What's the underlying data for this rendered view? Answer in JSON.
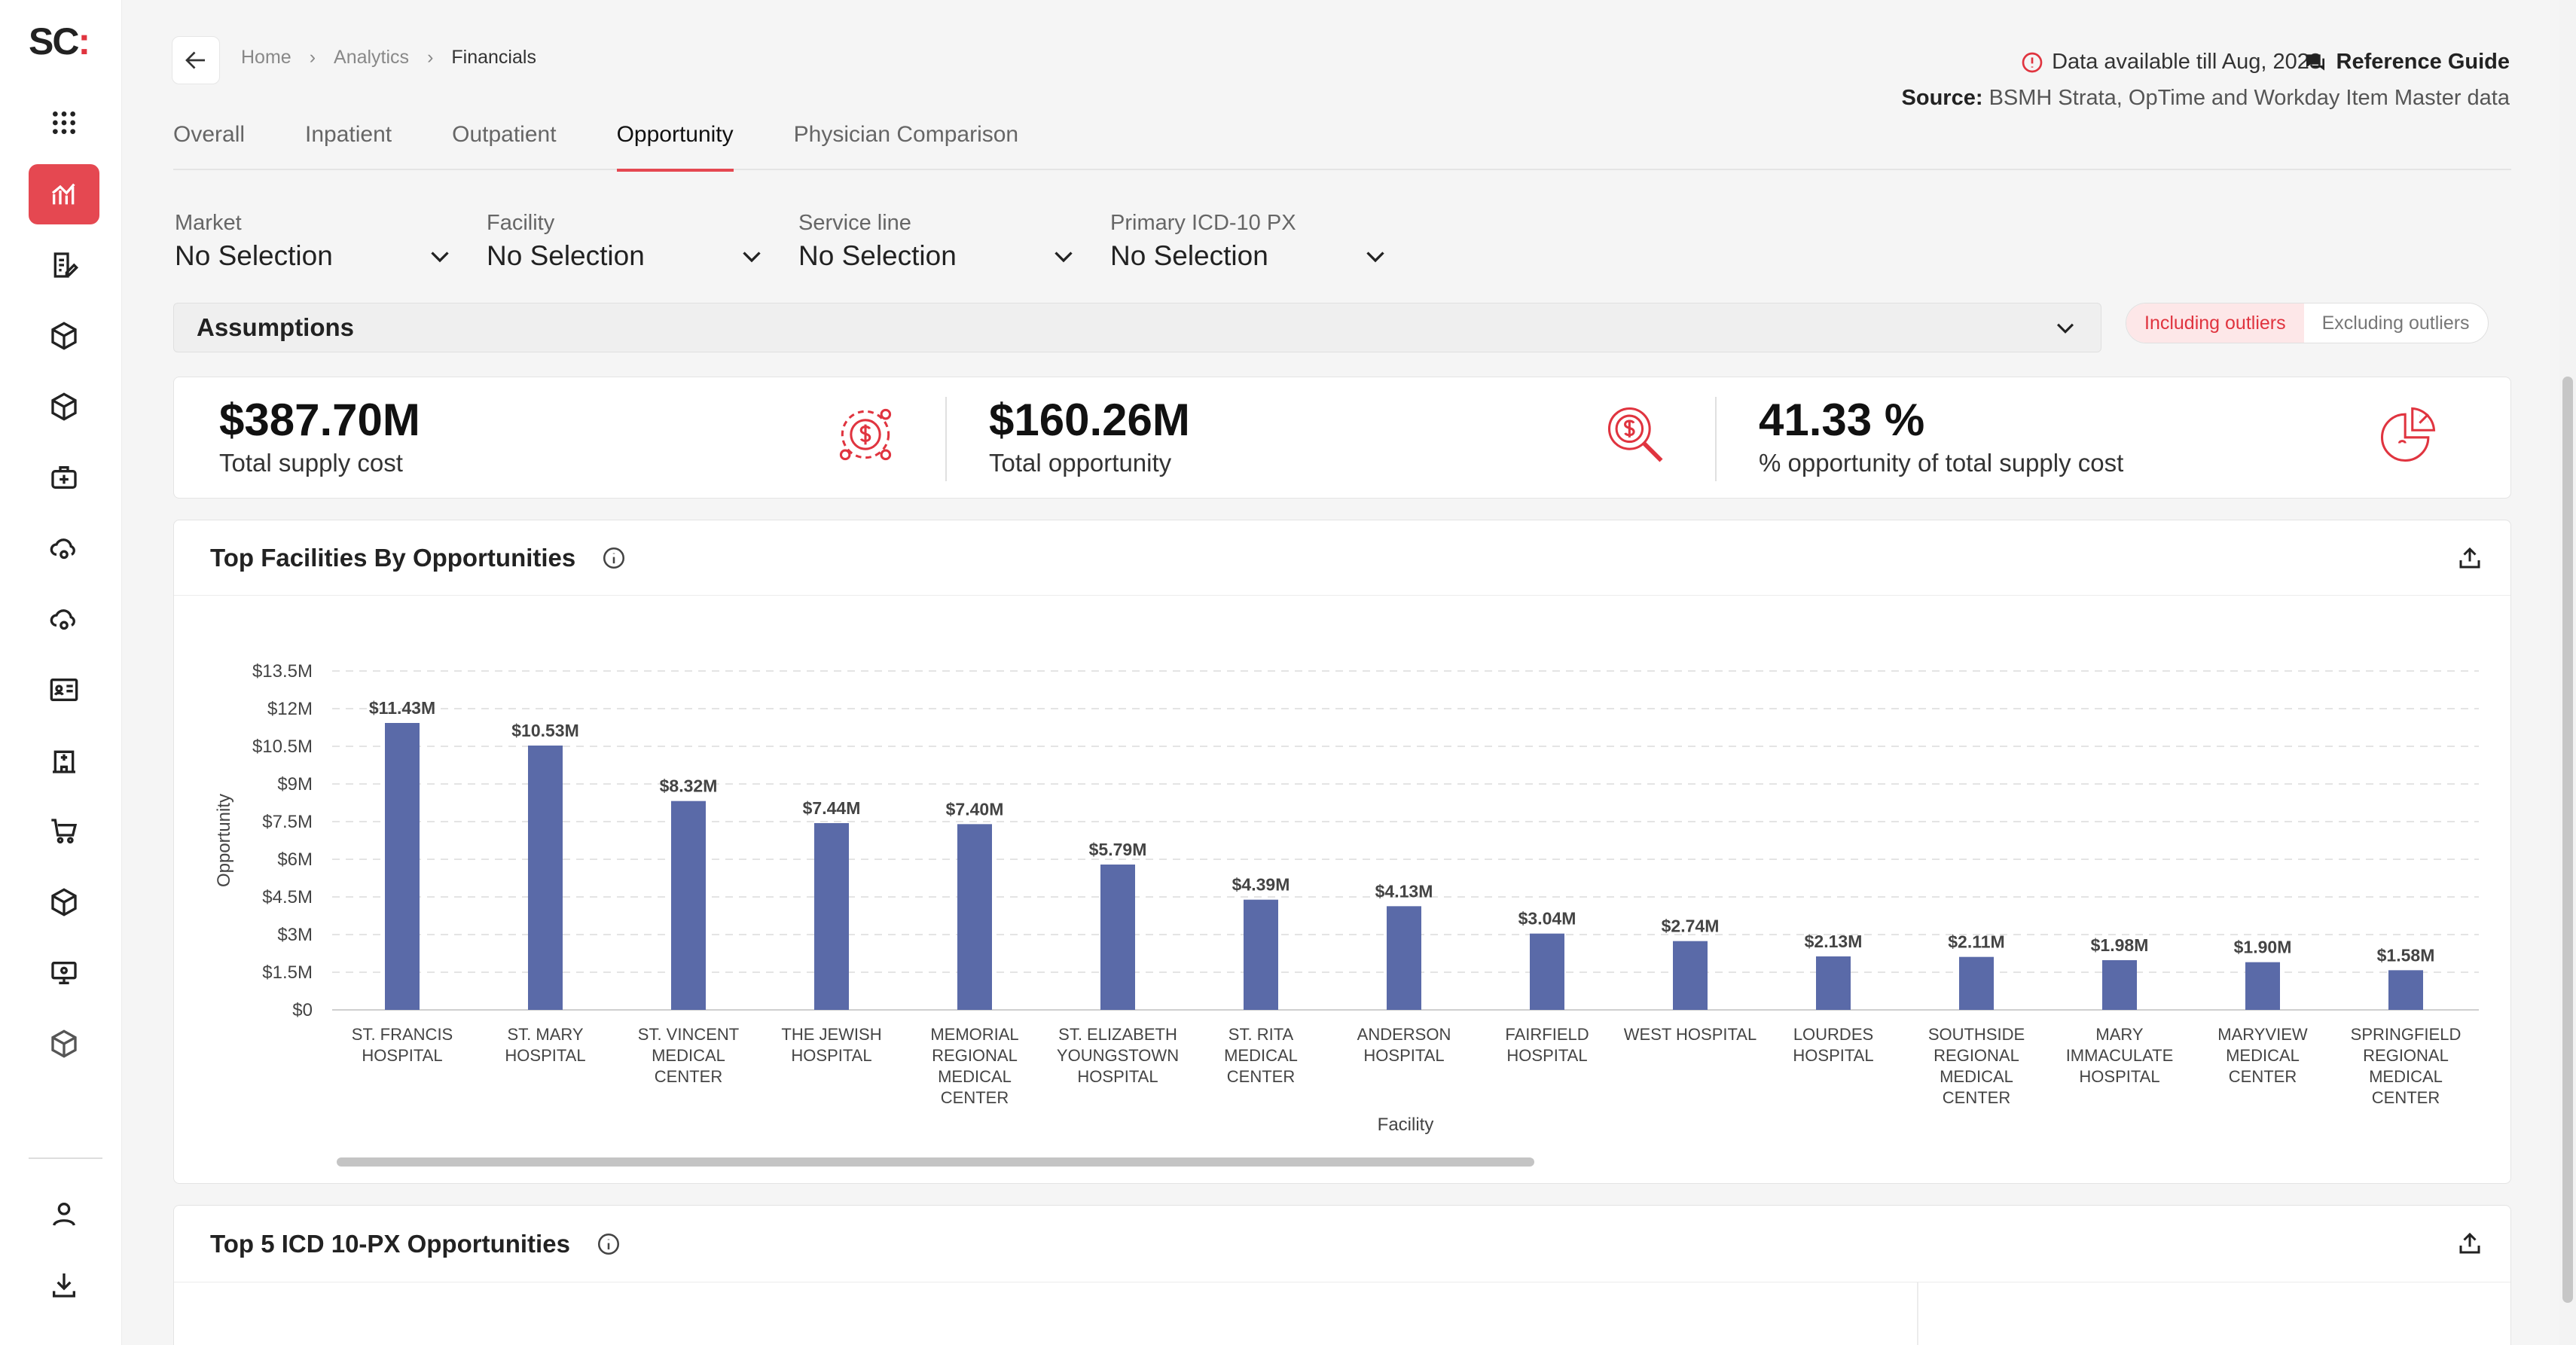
{
  "app": {
    "logo_text": "SC",
    "logo_mark": ":"
  },
  "sidebar": {
    "items": [
      {
        "name": "apps-grid-icon"
      },
      {
        "name": "analytics-chart-icon",
        "active": true
      },
      {
        "name": "document-edit-icon"
      },
      {
        "name": "box-icon"
      },
      {
        "name": "box-icon"
      },
      {
        "name": "medical-kit-icon"
      },
      {
        "name": "cloud-settings-icon"
      },
      {
        "name": "cloud-settings-icon"
      },
      {
        "name": "id-card-icon"
      },
      {
        "name": "hospital-building-icon"
      },
      {
        "name": "cart-icon"
      },
      {
        "name": "box-icon"
      },
      {
        "name": "monitor-icon"
      },
      {
        "name": "box-icon"
      }
    ],
    "bottom": [
      {
        "name": "user-icon"
      },
      {
        "name": "download-icon"
      }
    ]
  },
  "breadcrumb": {
    "home": "Home",
    "analytics": "Analytics",
    "current": "Financials"
  },
  "header": {
    "data_note": "Data available till Aug, 2023",
    "reference_guide": "Reference Guide",
    "source_label": "Source:",
    "source_text": " BSMH Strata, OpTime and Workday Item Master data"
  },
  "tabs": [
    {
      "label": "Overall",
      "active": false
    },
    {
      "label": "Inpatient",
      "active": false
    },
    {
      "label": "Outpatient",
      "active": false
    },
    {
      "label": "Opportunity",
      "active": true
    },
    {
      "label": "Physician Comparison",
      "active": false
    }
  ],
  "filters": [
    {
      "label": "Market",
      "value": "No Selection"
    },
    {
      "label": "Facility",
      "value": "No Selection"
    },
    {
      "label": "Service line",
      "value": "No Selection"
    },
    {
      "label": "Primary ICD-10 PX",
      "value": "No Selection"
    }
  ],
  "assumptions": {
    "title": "Assumptions"
  },
  "outliers": {
    "including": "Including outliers",
    "excluding": "Excluding outliers",
    "selected": "including"
  },
  "kpis": [
    {
      "value": "$387.70M",
      "label": "Total supply cost",
      "icon": "money-gear-icon"
    },
    {
      "value": "$160.26M",
      "label": "Total opportunity",
      "icon": "dollar-search-icon"
    },
    {
      "value": "41.33 %",
      "label": "% opportunity of total supply cost",
      "icon": "pie-percent-icon"
    }
  ],
  "colors": {
    "accent": "#e54851",
    "bar": "#5a6aa8"
  },
  "chart_card": {
    "title": "Top Facilities By Opportunities"
  },
  "chart_data": {
    "type": "bar",
    "title": "Top Facilities By Opportunities",
    "xlabel": "Facility",
    "ylabel": "Opportunity",
    "categories": [
      "ST. FRANCIS HOSPITAL",
      "ST. MARY HOSPITAL",
      "ST. VINCENT MEDICAL CENTER",
      "THE JEWISH HOSPITAL",
      "MEMORIAL REGIONAL MEDICAL CENTER",
      "ST. ELIZABETH YOUNGSTOWN HOSPITAL",
      "ST. RITA MEDICAL CENTER",
      "ANDERSON HOSPITAL",
      "FAIRFIELD HOSPITAL",
      "WEST HOSPITAL",
      "LOURDES HOSPITAL",
      "SOUTHSIDE REGIONAL MEDICAL CENTER",
      "MARY IMMACULATE HOSPITAL",
      "MARYVIEW MEDICAL CENTER",
      "SPRINGFIELD REGIONAL MEDICAL CENTER"
    ],
    "category_lines": [
      [
        "ST. FRANCIS",
        "HOSPITAL"
      ],
      [
        "ST. MARY",
        "HOSPITAL"
      ],
      [
        "ST. VINCENT",
        "MEDICAL",
        "CENTER"
      ],
      [
        "THE JEWISH",
        "HOSPITAL"
      ],
      [
        "MEMORIAL",
        "REGIONAL",
        "MEDICAL",
        "CENTER"
      ],
      [
        "ST. ELIZABETH",
        "YOUNGSTOWN",
        "HOSPITAL"
      ],
      [
        "ST. RITA",
        "MEDICAL",
        "CENTER"
      ],
      [
        "ANDERSON",
        "HOSPITAL"
      ],
      [
        "FAIRFIELD",
        "HOSPITAL"
      ],
      [
        "WEST HOSPITAL"
      ],
      [
        "LOURDES",
        "HOSPITAL"
      ],
      [
        "SOUTHSIDE",
        "REGIONAL",
        "MEDICAL",
        "CENTER"
      ],
      [
        "MARY",
        "IMMACULATE",
        "HOSPITAL"
      ],
      [
        "MARYVIEW",
        "MEDICAL",
        "CENTER"
      ],
      [
        "SPRINGFIELD",
        "REGIONAL",
        "MEDICAL",
        "CENTER"
      ]
    ],
    "values": [
      11.43,
      10.53,
      8.32,
      7.44,
      7.4,
      5.79,
      4.39,
      4.13,
      3.04,
      2.74,
      2.13,
      2.11,
      1.98,
      1.9,
      1.58
    ],
    "value_labels": [
      "$11.43M",
      "$10.53M",
      "$8.32M",
      "$7.44M",
      "$7.40M",
      "$5.79M",
      "$4.39M",
      "$4.13M",
      "$3.04M",
      "$2.74M",
      "$2.13M",
      "$2.11M",
      "$1.98M",
      "$1.90M",
      "$1.58M"
    ],
    "ylim": [
      0,
      13.5
    ],
    "yticks": [
      0,
      1.5,
      3,
      4.5,
      6,
      7.5,
      9,
      10.5,
      12,
      13.5
    ],
    "ytick_labels": [
      "$0",
      "$1.5M",
      "$3M",
      "$4.5M",
      "$6M",
      "$7.5M",
      "$9M",
      "$10.5M",
      "$12M",
      "$13.5M"
    ],
    "grid": true
  },
  "bottom_card": {
    "title": "Top 5 ICD 10-PX Opportunities"
  }
}
